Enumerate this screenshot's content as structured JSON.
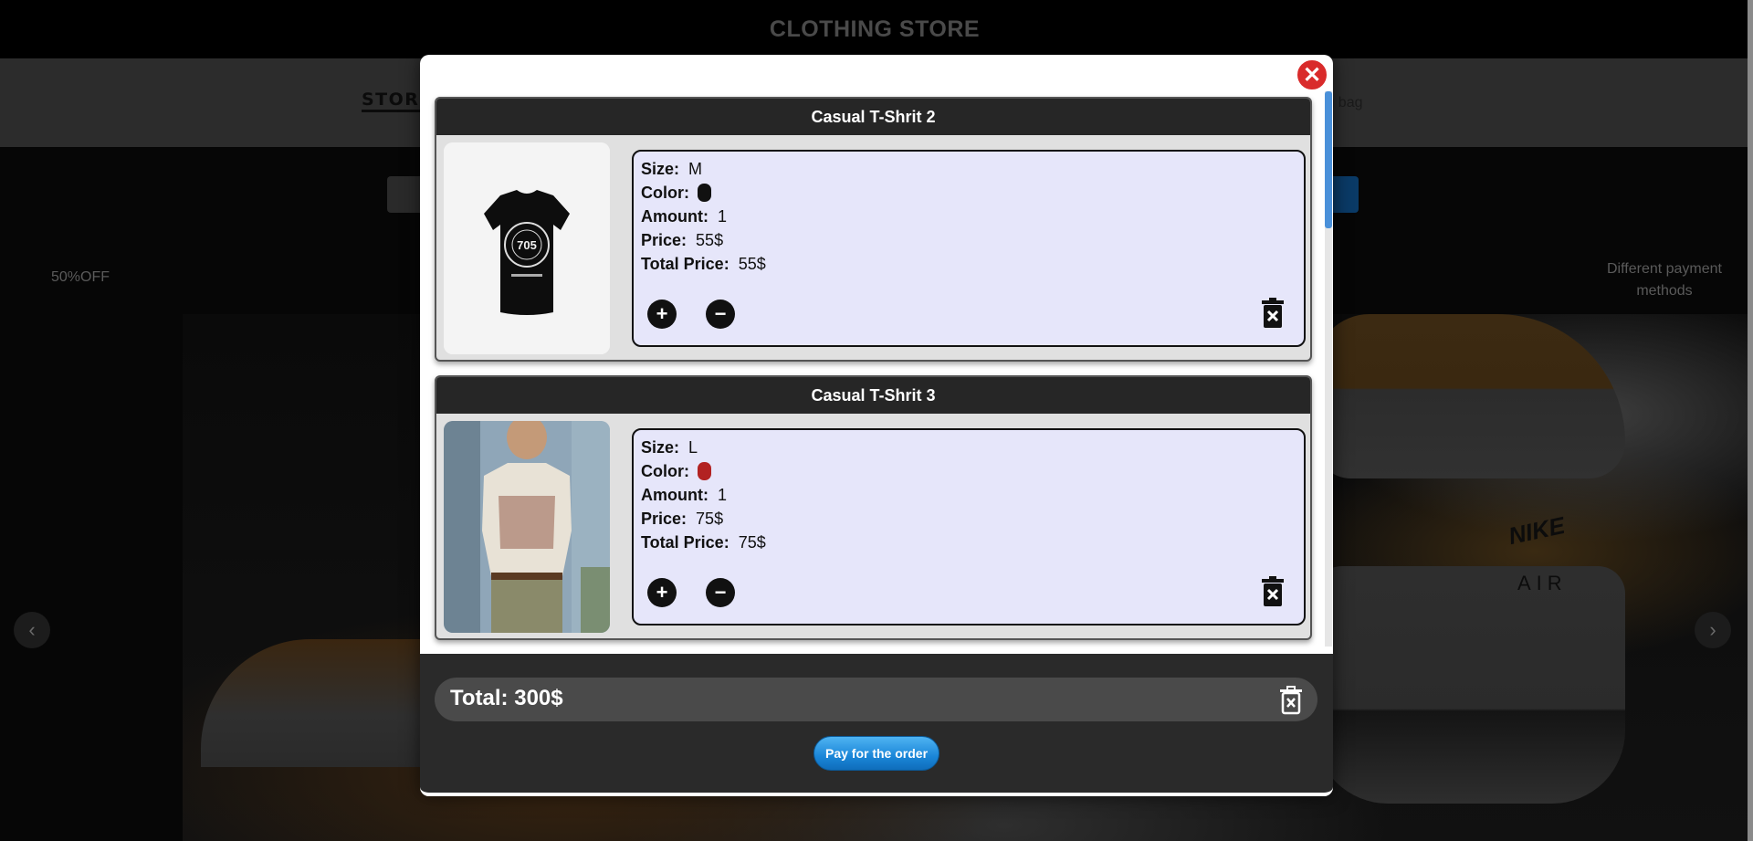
{
  "app": {
    "title": "CLOTHING STORE"
  },
  "nav": {
    "logo": "STORE",
    "bag_text": "ing bag"
  },
  "promo": {
    "left": "50%OFF",
    "right": "Different payment methods"
  },
  "hero": {
    "brand_text": "NIKE",
    "sub_text": "AIR"
  },
  "cart": {
    "items": [
      {
        "title": "Casual T-Shrit 2",
        "size_label": "Size:",
        "size": "M",
        "color_label": "Color:",
        "color": "#111111",
        "amount_label": "Amount:",
        "amount": "1",
        "price_label": "Price:",
        "price": "55$",
        "total_label": "Total Price:",
        "total": "55$",
        "image_icon": "black-tshirt-image"
      },
      {
        "title": "Casual T-Shrit 3",
        "size_label": "Size:",
        "size": "L",
        "color_label": "Color:",
        "color": "#b22222",
        "amount_label": "Amount:",
        "amount": "1",
        "price_label": "Price:",
        "price": "75$",
        "total_label": "Total Price:",
        "total": "75$",
        "image_icon": "model-wearing-tshirt-image"
      }
    ],
    "total_label": "Total:",
    "total_value": "300$",
    "pay_button": "Pay for the order",
    "plus_glyph": "+",
    "minus_glyph": "−",
    "close_glyph": "✕"
  },
  "carousel": {
    "left_glyph": "‹",
    "right_glyph": "›"
  },
  "colors": {
    "accent": "#1a86d8",
    "close": "#d92b2b",
    "info_bg": "#e6e6fa",
    "header": "#262626"
  }
}
